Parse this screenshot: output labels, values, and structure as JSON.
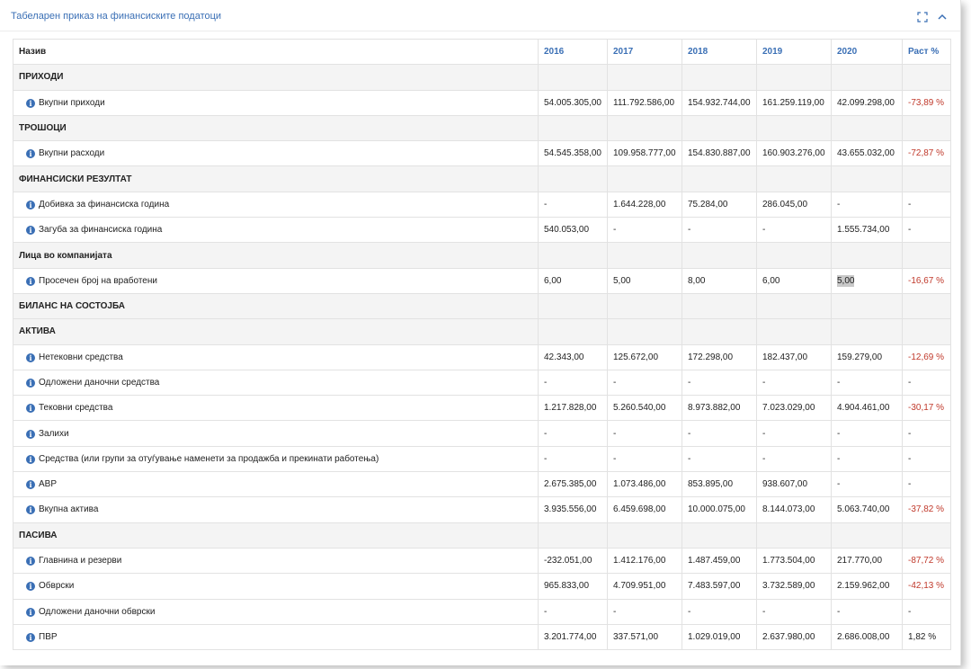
{
  "panel": {
    "title": "Табеларен приказ на финансиските податоци"
  },
  "table": {
    "headers": [
      "Назив",
      "2016",
      "2017",
      "2018",
      "2019",
      "2020",
      "Раст %"
    ],
    "rows": [
      {
        "type": "section",
        "label": "ПРИХОДИ"
      },
      {
        "type": "row",
        "label": "Вкупни приходи",
        "values": [
          "54.005.305,00",
          "111.792.586,00",
          "154.932.744,00",
          "161.259.119,00",
          "42.099.298,00"
        ],
        "growth": "-73,89 %",
        "growth_negative": true
      },
      {
        "type": "section",
        "label": "ТРОШОЦИ"
      },
      {
        "type": "row",
        "label": "Вкупни расходи",
        "values": [
          "54.545.358,00",
          "109.958.777,00",
          "154.830.887,00",
          "160.903.276,00",
          "43.655.032,00"
        ],
        "growth": "-72,87 %",
        "growth_negative": true
      },
      {
        "type": "section",
        "label": "ФИНАНСИСКИ РЕЗУЛТАТ"
      },
      {
        "type": "row",
        "label": "Добивка за финансиска година",
        "values": [
          "-",
          "1.644.228,00",
          "75.284,00",
          "286.045,00",
          "-"
        ],
        "growth": "-",
        "growth_negative": false
      },
      {
        "type": "row",
        "label": "Загуба за финансиска година",
        "values": [
          "540.053,00",
          "-",
          "-",
          "-",
          "1.555.734,00"
        ],
        "growth": "-",
        "growth_negative": false
      },
      {
        "type": "section",
        "label": "Лица во компанијата"
      },
      {
        "type": "row",
        "label": "Просечен број на вработени",
        "values": [
          "6,00",
          "5,00",
          "8,00",
          "6,00",
          "5,00"
        ],
        "growth": "-16,67 %",
        "growth_negative": true,
        "highlight_col": 4
      },
      {
        "type": "section",
        "label": "БИЛАНС НА СОСТОЈБА"
      },
      {
        "type": "section",
        "label": "АКТИВА"
      },
      {
        "type": "row",
        "label": "Нетековни средства",
        "values": [
          "42.343,00",
          "125.672,00",
          "172.298,00",
          "182.437,00",
          "159.279,00"
        ],
        "growth": "-12,69 %",
        "growth_negative": true
      },
      {
        "type": "row",
        "label": "Одложени даночни средства",
        "values": [
          "-",
          "-",
          "-",
          "-",
          "-"
        ],
        "growth": "-",
        "growth_negative": false
      },
      {
        "type": "row",
        "label": "Тековни средства",
        "values": [
          "1.217.828,00",
          "5.260.540,00",
          "8.973.882,00",
          "7.023.029,00",
          "4.904.461,00"
        ],
        "growth": "-30,17 %",
        "growth_negative": true
      },
      {
        "type": "row",
        "label": "Залихи",
        "values": [
          "-",
          "-",
          "-",
          "-",
          "-"
        ],
        "growth": "-",
        "growth_negative": false
      },
      {
        "type": "row",
        "label": "Средства (или групи за отуѓување наменети за продажба и прекинати работења)",
        "values": [
          "-",
          "-",
          "-",
          "-",
          "-"
        ],
        "growth": "-",
        "growth_negative": false
      },
      {
        "type": "row",
        "label": "АВР",
        "values": [
          "2.675.385,00",
          "1.073.486,00",
          "853.895,00",
          "938.607,00",
          "-"
        ],
        "growth": "-",
        "growth_negative": false
      },
      {
        "type": "row",
        "label": "Вкупна актива",
        "values": [
          "3.935.556,00",
          "6.459.698,00",
          "10.000.075,00",
          "8.144.073,00",
          "5.063.740,00"
        ],
        "growth": "-37,82 %",
        "growth_negative": true
      },
      {
        "type": "section",
        "label": "ПАСИВА"
      },
      {
        "type": "row",
        "label": "Главнина и резерви",
        "values": [
          "-232.051,00",
          "1.412.176,00",
          "1.487.459,00",
          "1.773.504,00",
          "217.770,00"
        ],
        "growth": "-87,72 %",
        "growth_negative": true
      },
      {
        "type": "row",
        "label": "Обврски",
        "values": [
          "965.833,00",
          "4.709.951,00",
          "7.483.597,00",
          "3.732.589,00",
          "2.159.962,00"
        ],
        "growth": "-42,13 %",
        "growth_negative": true
      },
      {
        "type": "row",
        "label": "Одложени даночни обврски",
        "values": [
          "-",
          "-",
          "-",
          "-",
          "-"
        ],
        "growth": "-",
        "growth_negative": false
      },
      {
        "type": "row",
        "label": "ПВР",
        "values": [
          "3.201.774,00",
          "337.571,00",
          "1.029.019,00",
          "2.637.980,00",
          "2.686.008,00"
        ],
        "growth": "1,82 %",
        "growth_negative": false
      }
    ]
  },
  "icons": {
    "expand": "expand-icon",
    "collapse": "chevron-up-icon",
    "info": "info-icon"
  },
  "colors": {
    "accent": "#3a6fb5",
    "negative": "#c0392b",
    "section_bg": "#f4f4f4"
  }
}
